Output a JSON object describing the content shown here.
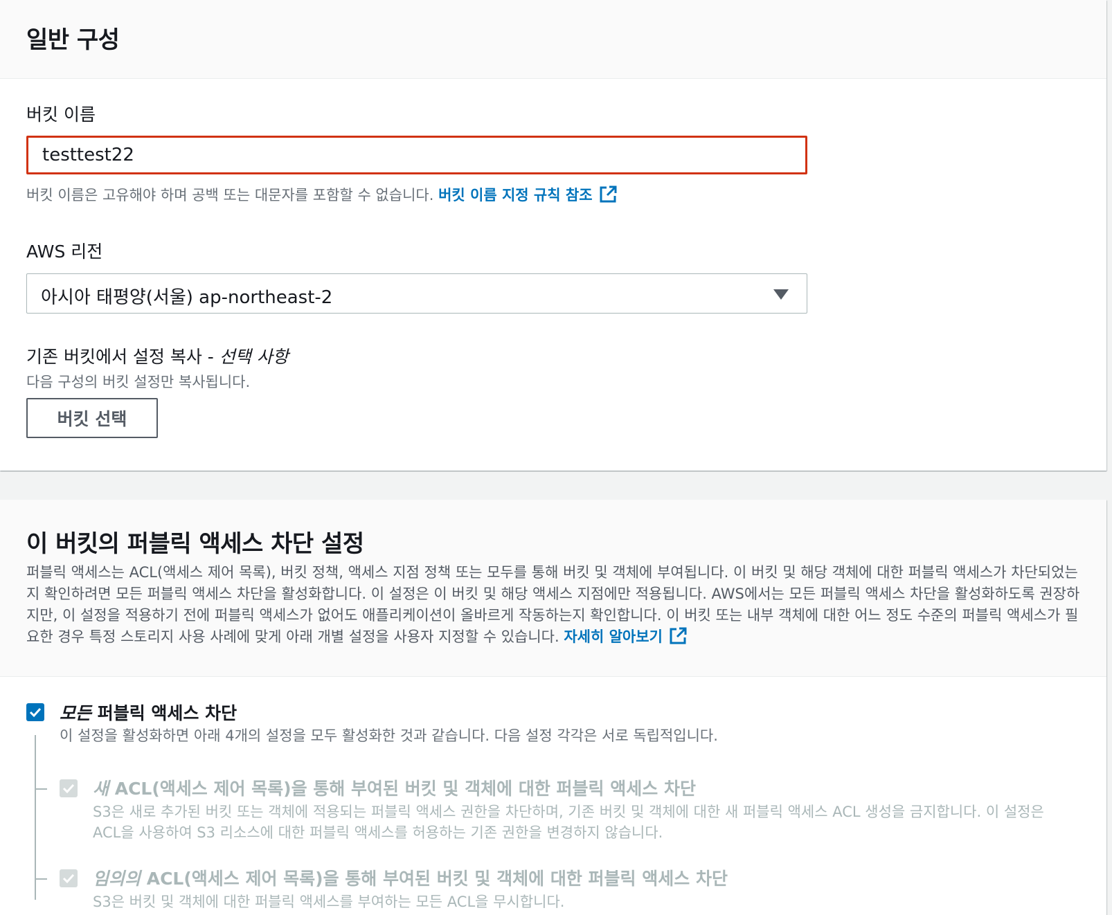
{
  "general": {
    "title": "일반 구성",
    "bucket_name_label": "버킷 이름",
    "bucket_name_value": "testtest22",
    "bucket_name_hint": "버킷 이름은 고유해야 하며 공백 또는 대문자를 포함할 수 없습니다.",
    "bucket_name_rules_link": "버킷 이름 지정 규칙 참조",
    "region_label": "AWS 리전",
    "region_value": "아시아 태평양(서울) ap-northeast-2",
    "copy_label_main": "기존 버킷에서 설정 복사 - ",
    "copy_label_optional": "선택 사항",
    "copy_hint": "다음 구성의 버킷 설정만 복사됩니다.",
    "choose_bucket_button": "버킷 선택"
  },
  "public_access": {
    "title": "이 버킷의 퍼블릭 액세스 차단 설정",
    "description": "퍼블릭 액세스는 ACL(액세스 제어 목록), 버킷 정책, 액세스 지점 정책 또는 모두를 통해 버킷 및 객체에 부여됩니다. 이 버킷 및 해당 객체에 대한 퍼블릭 액세스가 차단되었는지 확인하려면 모든 퍼블릭 액세스 차단을 활성화합니다. 이 설정은 이 버킷 및 해당 액세스 지점에만 적용됩니다. AWS에서는 모든 퍼블릭 액세스 차단을 활성화하도록 권장하지만, 이 설정을 적용하기 전에 퍼블릭 액세스가 없어도 애플리케이션이 올바르게 작동하는지 확인합니다. 이 버킷 또는 내부 객체에 대한 어느 정도 수준의 퍼블릭 액세스가 필요한 경우 특정 스토리지 사용 사례에 맞게 아래 개별 설정을 사용자 지정할 수 있습니다.",
    "learn_more_link": "자세히 알아보기",
    "block_all": {
      "title_italic": "모든",
      "title_rest": " 퍼블릭 액세스 차단",
      "desc": "이 설정을 활성화하면 아래 4개의 설정을 모두 활성화한 것과 같습니다. 다음 설정 각각은 서로 독립적입니다.",
      "checked": true
    },
    "options": [
      {
        "title_italic": "새",
        "title_rest": " ACL(액세스 제어 목록)을 통해 부여된 버킷 및 객체에 대한 퍼블릭 액세스 차단",
        "desc": "S3은 새로 추가된 버킷 또는 객체에 적용되는 퍼블릭 액세스 권한을 차단하며, 기존 버킷 및 객체에 대한 새 퍼블릭 액세스 ACL 생성을 금지합니다. 이 설정은 ACL을 사용하여 S3 리소스에 대한 퍼블릭 액세스를 허용하는 기존 권한을 변경하지 않습니다.",
        "checked": true
      },
      {
        "title_italic": "임의의",
        "title_rest": " ACL(액세스 제어 목록)을 통해 부여된 버킷 및 객체에 대한 퍼블릭 액세스 차단",
        "desc": "S3은 버킷 및 객체에 대한 퍼블릭 액세스를 부여하는 모든 ACL을 무시합니다.",
        "checked": true
      }
    ]
  }
}
